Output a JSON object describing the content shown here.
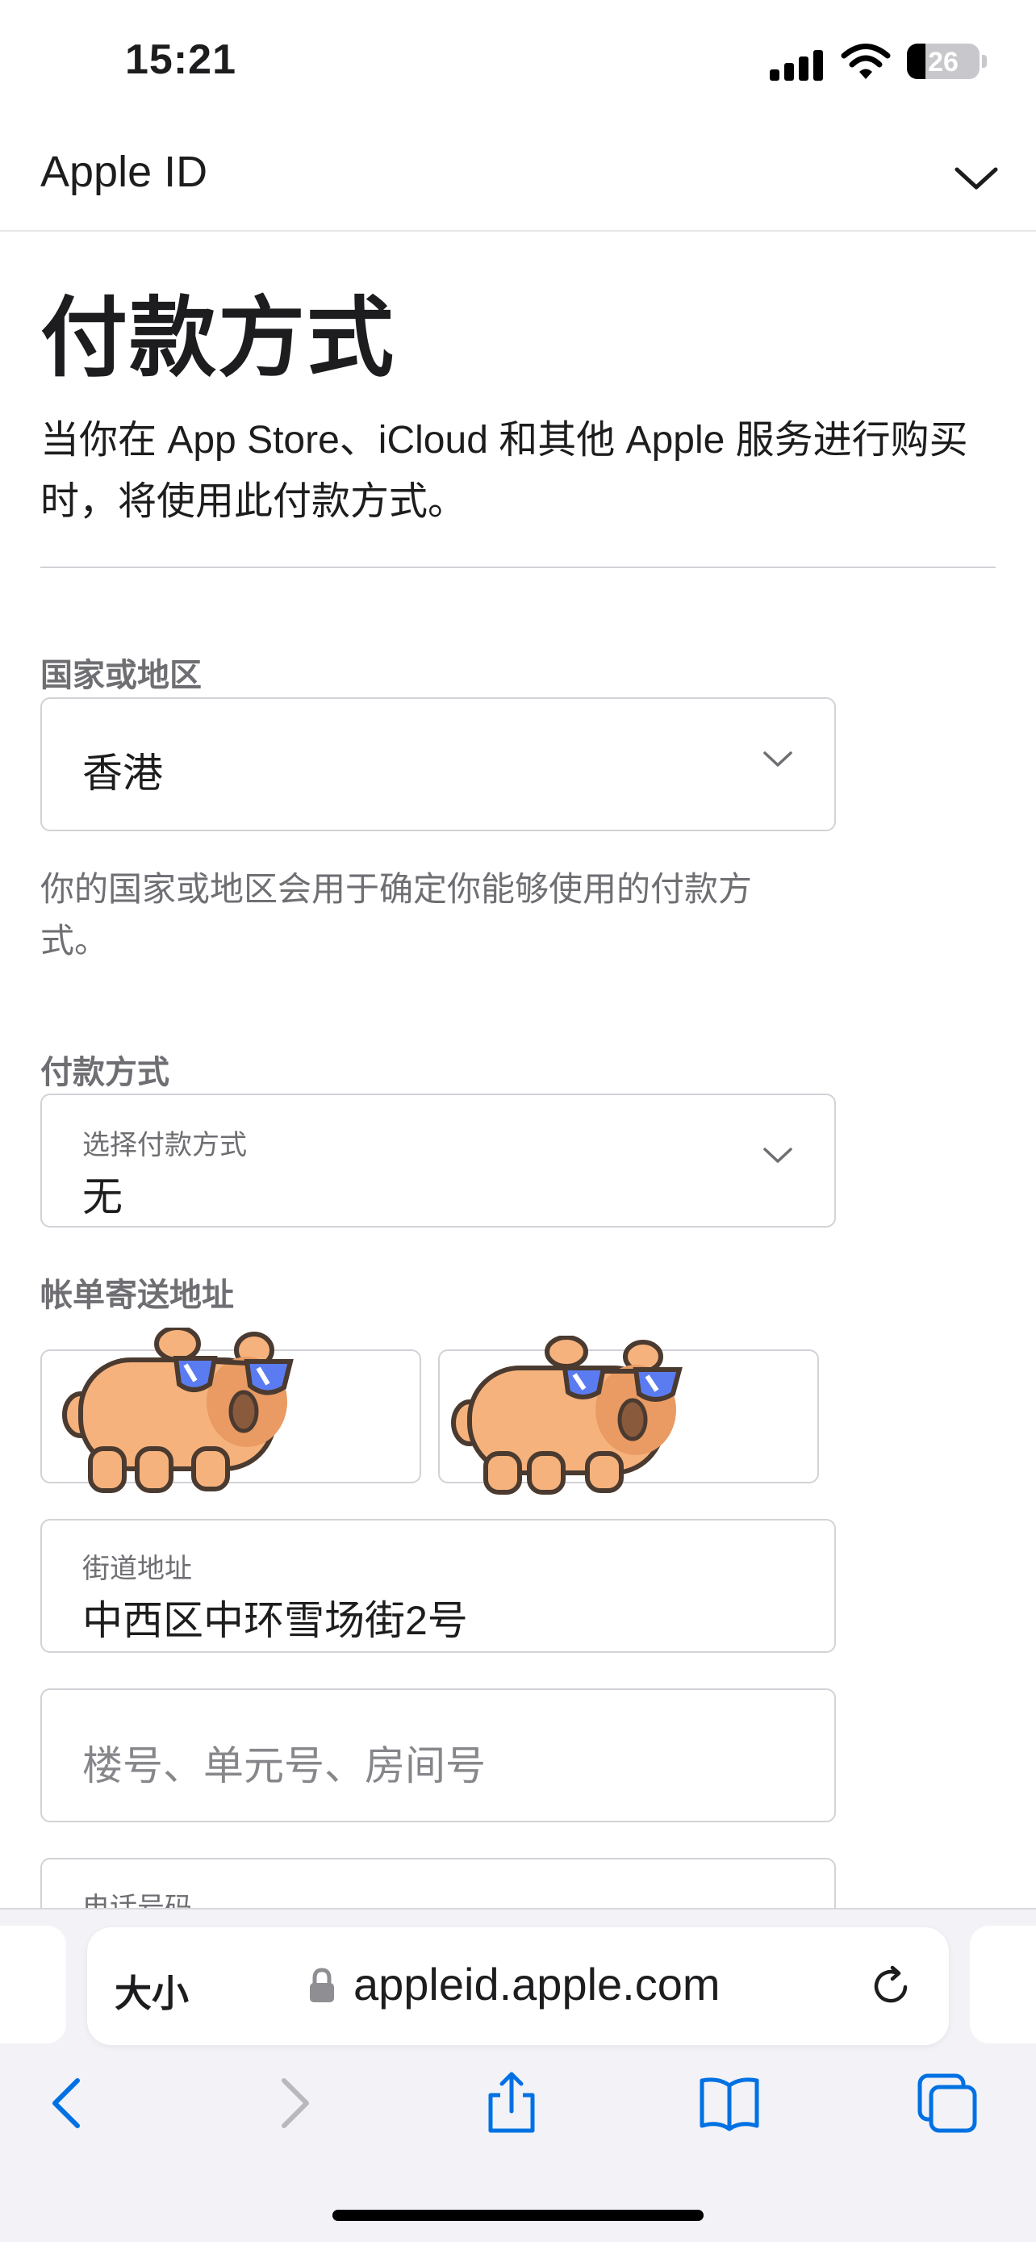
{
  "status_bar": {
    "time": "15:21",
    "battery_percent": "26",
    "battery_level": 0.26
  },
  "header": {
    "title": "Apple ID",
    "menu_icon": "chevron-down-icon"
  },
  "page": {
    "title": "付款方式",
    "intro": "当你在 App Store、iCloud 和其他 Apple 服务进行购买时，将使用此付款方式。"
  },
  "country": {
    "label": "国家或地区",
    "value": "香港",
    "help": "你的国家或地区会用于确定你能够使用的付款方式。"
  },
  "payment": {
    "label": "付款方式",
    "select_label": "选择付款方式",
    "value": "无"
  },
  "billing": {
    "label": "帐单寄送地址",
    "street_label": "街道地址",
    "street_value": "中西区中环雪场街2号",
    "unit_placeholder": "楼号、单元号、房间号",
    "phone_label": "电话号码"
  },
  "browser": {
    "text_size_label": "大小",
    "url": "appleid.apple.com"
  },
  "colors": {
    "accent": "#0071e3",
    "text": "#1d1d1f",
    "secondary_text": "#6e6e73",
    "border": "#d2d2d7",
    "toolbar_bg": "#f2f2f7",
    "sticker_fur": "#f6b27c",
    "sticker_glasses": "#5b7cf0"
  }
}
